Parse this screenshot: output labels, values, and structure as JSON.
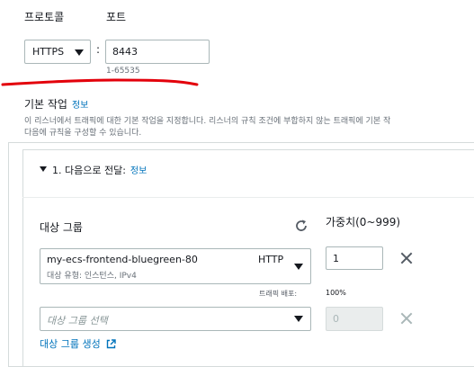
{
  "protocol": {
    "label": "프로토콜",
    "value": "HTTPS",
    "separator": ":"
  },
  "port": {
    "label": "포트",
    "value": "8443",
    "hint": "1-65535"
  },
  "default_actions": {
    "title": "기본 작업",
    "info": "정보",
    "description_line1": "이 리스너에서 트래픽에 대한 기본 작업을 지정합니다. 리스너의 규칙 조건에 부합하지 않는 트래픽에 기본 작",
    "description_line2": "다음에 규칙을 구성할 수 있습니다."
  },
  "action": {
    "title": "1. 다음으로 전달:",
    "info": "정보",
    "target_group_header": "대상 그룹",
    "weight_header": "가중치(0~999)",
    "rows": [
      {
        "name": "my-ecs-frontend-bluegreen-80",
        "protocol": "HTTP",
        "subtitle": "대상 유형: 인스턴스, IPv4",
        "weight": "1",
        "traffic_label": "트래픽 배포:",
        "traffic_value": "100%"
      },
      {
        "placeholder": "대상 그룹 선택",
        "weight": "0"
      }
    ],
    "create_link": "대상 그룹 생성"
  },
  "colors": {
    "link": "#0073bb",
    "annotation": "#e3000b",
    "border": "#aab7b8"
  },
  "icons": [
    "caret-down-icon",
    "refresh-icon",
    "remove-icon",
    "external-link-icon"
  ]
}
